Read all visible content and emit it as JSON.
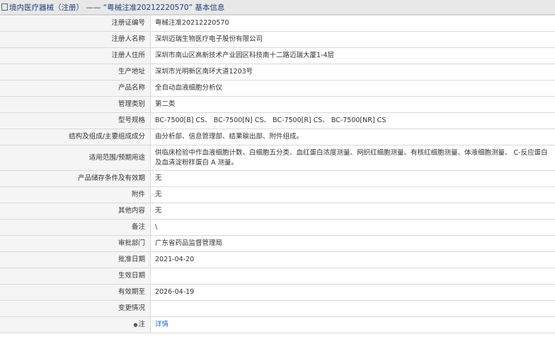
{
  "header": {
    "title": "境内医疗器械（注册） —— “粤械注准20212220570” 基本信息"
  },
  "rows": [
    {
      "label": "注册证编号",
      "value": "粤械注准20212220570"
    },
    {
      "label": "注册人名称",
      "value": "深圳迈瑞生物医疗电子股份有限公司"
    },
    {
      "label": "注册人住所",
      "value": "深圳市南山区高新技术产业园区科技南十二路迈瑞大厦1-4层"
    },
    {
      "label": "生产地址",
      "value": "深圳市光明新区南环大道1203号"
    },
    {
      "label": "产品名称",
      "value": "全自动血液细胞分析仪"
    },
    {
      "label": "管理类别",
      "value": "第二类"
    },
    {
      "label": "型号规格",
      "value": "BC-7500[B] CS、 BC-7500[N] CS、 BC-7500[R] CS、 BC-7500[NR] CS"
    },
    {
      "label": "结构及组成/主要组成成分",
      "value": "由分析部、信息管理部、结果输出部、附件组成。"
    },
    {
      "label": "适用范围/预期用途",
      "value": "供临床检验中作血液细胞计数、白细胞五分类、血红蛋白浓度测量、网织红细胞测量、有核红细胞测量、体液细胞测量、 C-反应蛋白及血清淀粉样蛋白 A 测量。"
    },
    {
      "label": "产品储存条件及有效期",
      "value": "无"
    },
    {
      "label": "附件",
      "value": "无"
    },
    {
      "label": "其他内容",
      "value": "无"
    },
    {
      "label": "备注",
      "value": "\\"
    },
    {
      "label": "审批部门",
      "value": "广东省药品监督管理局"
    },
    {
      "label": "批准日期",
      "value": "2021-04-20"
    },
    {
      "label": "生效日期",
      "value": ""
    },
    {
      "label": "有效期至",
      "value": "2026-04-19"
    },
    {
      "label": "变更情况",
      "value": ""
    }
  ],
  "note_row": {
    "label": "注",
    "link": "详情"
  }
}
